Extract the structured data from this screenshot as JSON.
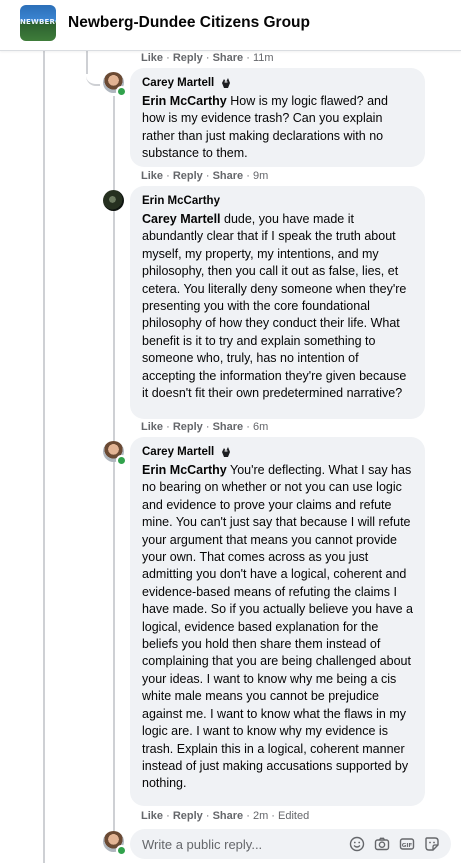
{
  "header": {
    "group_name": "Newberg-Dundee Citizens Group",
    "logo_text": "NEWBERG"
  },
  "action_labels": {
    "like": "Like",
    "reply": "Reply",
    "share": "Share",
    "dot": "·"
  },
  "top_meta": {
    "time": "11m"
  },
  "comments": [
    {
      "author": "Carey Martell",
      "mention": "Erin McCarthy",
      "text": "How is my logic flawed? and how is my evidence trash? Can you explain rather than just making declarations with no substance to them.",
      "time": "9m",
      "edited": ""
    },
    {
      "author": "Erin McCarthy",
      "mention": "Carey Martell",
      "text": "dude, you have made it abundantly clear that if I speak the truth about myself, my property, my intentions, and my philosophy, then you call it out as false, lies, et cetera. You literally deny someone when they're presenting you with the core foundational philosophy of how they conduct their life. What benefit is it to try and explain something to someone who, truly, has no intention of accepting the information they're given because it doesn't fit their own predetermined narrative?",
      "time": "6m",
      "edited": ""
    },
    {
      "author": "Carey Martell",
      "mention": "Erin McCarthy",
      "text": "You're deflecting. What I say has no bearing on whether or not you can use logic and evidence to prove your claims and refute mine. You can't just say that because I will refute your argument that means you cannot provide your own. That comes across as you just admitting you don't have a logical, coherent and evidence-based means of refuting the claims I have made. So if you actually believe you have a logical, evidence based explanation for the beliefs you hold then share them instead of complaining that you are being challenged about your ideas. I want to know why me being a cis white male means you cannot be prejudice against me. I want to know what the flaws in my logic are. I want to know why my evidence is trash. Explain this in a logical, coherent manner instead of just making accusations supported by nothing.",
      "time": "2m",
      "edited": "Edited"
    }
  ],
  "reply_box": {
    "placeholder": "Write a public reply...",
    "icons": [
      "emoji-icon",
      "camera-icon",
      "gif-icon",
      "sticker-icon"
    ]
  },
  "colors": {
    "bubble": "#f0f2f5",
    "meta": "#65676b",
    "online": "#31a24c",
    "thread": "#ced0d4"
  }
}
